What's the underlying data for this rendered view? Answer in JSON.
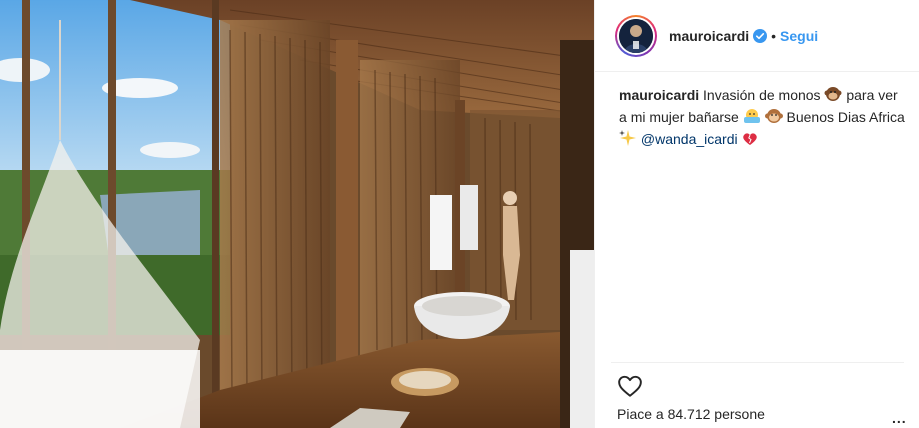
{
  "post": {
    "username": "mauroicardi",
    "follow_label": "Segui",
    "separator": "•",
    "caption": {
      "username": "mauroicardi",
      "line1": "Invasión de monos",
      "line1_end": "para ver a",
      "line2": "mi mujer bañarse",
      "line2_end": "Buenos Dias Africa",
      "mention": "@wanda_icardi"
    },
    "likes_text": "Piace a 84.712 persone",
    "more_label": "..."
  },
  "icons": {
    "verified": "verified-badge-icon",
    "heart": "heart-outline-icon",
    "more": "more-options-icon"
  },
  "colors": {
    "link_blue": "#3897f0",
    "mention": "#003569",
    "verified": "#3897f0",
    "text": "#262626"
  }
}
